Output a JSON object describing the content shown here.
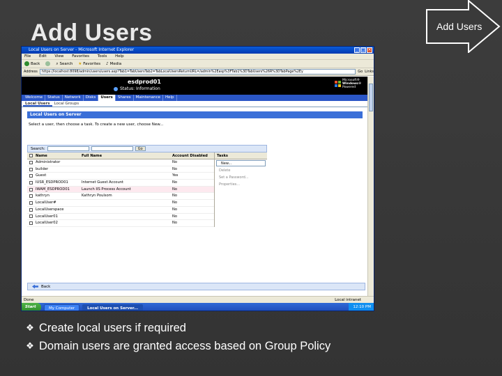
{
  "slide": {
    "title": "Add Users",
    "badge_label": "Add Users",
    "bullets": [
      "Create local users if required",
      "Domain users are granted access based on Group Policy"
    ],
    "bullet_icon": "diamond-bullet-icon"
  },
  "browser": {
    "title": "Local Users on Server - Microsoft Internet Explorer",
    "menu": [
      "File",
      "Edit",
      "View",
      "Favorites",
      "Tools",
      "Help"
    ],
    "toolbar": [
      "Back",
      "Search",
      "Favorites",
      "Media"
    ],
    "address_label": "Address",
    "address": "https://localhost:8098/admin/users/users.asp?Tab1=TabUsersTab2=TabLocalUsersReturnURL=/admin%2Easp%3FTab1%3DTabUsers%26R%3DTabPage%2Ey",
    "go_label": "Go",
    "links_label": "Links"
  },
  "app": {
    "server_name": "esdprod01",
    "status": "Status: Information",
    "logo_text": [
      "Microsoft®",
      "Windows®",
      "Powered"
    ],
    "nav_tabs": [
      "Welcome",
      "Status",
      "Network",
      "Disks",
      "Users",
      "Shares",
      "Maintenance",
      "Help"
    ],
    "active_nav": "Users",
    "sub_tabs": [
      "Local Users",
      "Local Groups"
    ],
    "section_title": "Local Users on Server",
    "instruction": "Select a user, then choose a task. To create a new user, choose New...",
    "search_label": "Search:",
    "go_button": "Go",
    "columns": [
      "Name",
      "Full Name",
      "Account Disabled"
    ],
    "tasks_header": "Tasks",
    "tasks": [
      "New...",
      "Delete",
      "Set a Password...",
      "Properties..."
    ],
    "rows": [
      {
        "name": "Administrator",
        "full": "",
        "disabled": "No"
      },
      {
        "name": "builder",
        "full": "",
        "disabled": "No"
      },
      {
        "name": "Guest",
        "full": "",
        "disabled": "Yes"
      },
      {
        "name": "IUSR_ESDPROD01",
        "full": "Internet Guest Account",
        "disabled": "No"
      },
      {
        "name": "IWAM_ESDPROD01",
        "full": "Launch IIS Process Account",
        "disabled": "No"
      },
      {
        "name": "kathryn",
        "full": "Kathryn Poulsom",
        "disabled": "No"
      },
      {
        "name": "LocalUser#",
        "full": "",
        "disabled": "No"
      },
      {
        "name": "LocalUserspace",
        "full": "",
        "disabled": "No"
      },
      {
        "name": "LocalUser01",
        "full": "",
        "disabled": "No"
      },
      {
        "name": "LocalUser02",
        "full": "",
        "disabled": "No"
      }
    ],
    "back_label": "Back"
  },
  "statusbar": {
    "left": "Done",
    "right": "Local intranet"
  },
  "taskbar": {
    "start": "Start",
    "tasks": [
      "My Computer",
      "Local Users on Server..."
    ],
    "clock": "12:10 PM"
  },
  "colors": {
    "accent": "#2a56c6",
    "slide_bg": "#3a3a3a"
  }
}
